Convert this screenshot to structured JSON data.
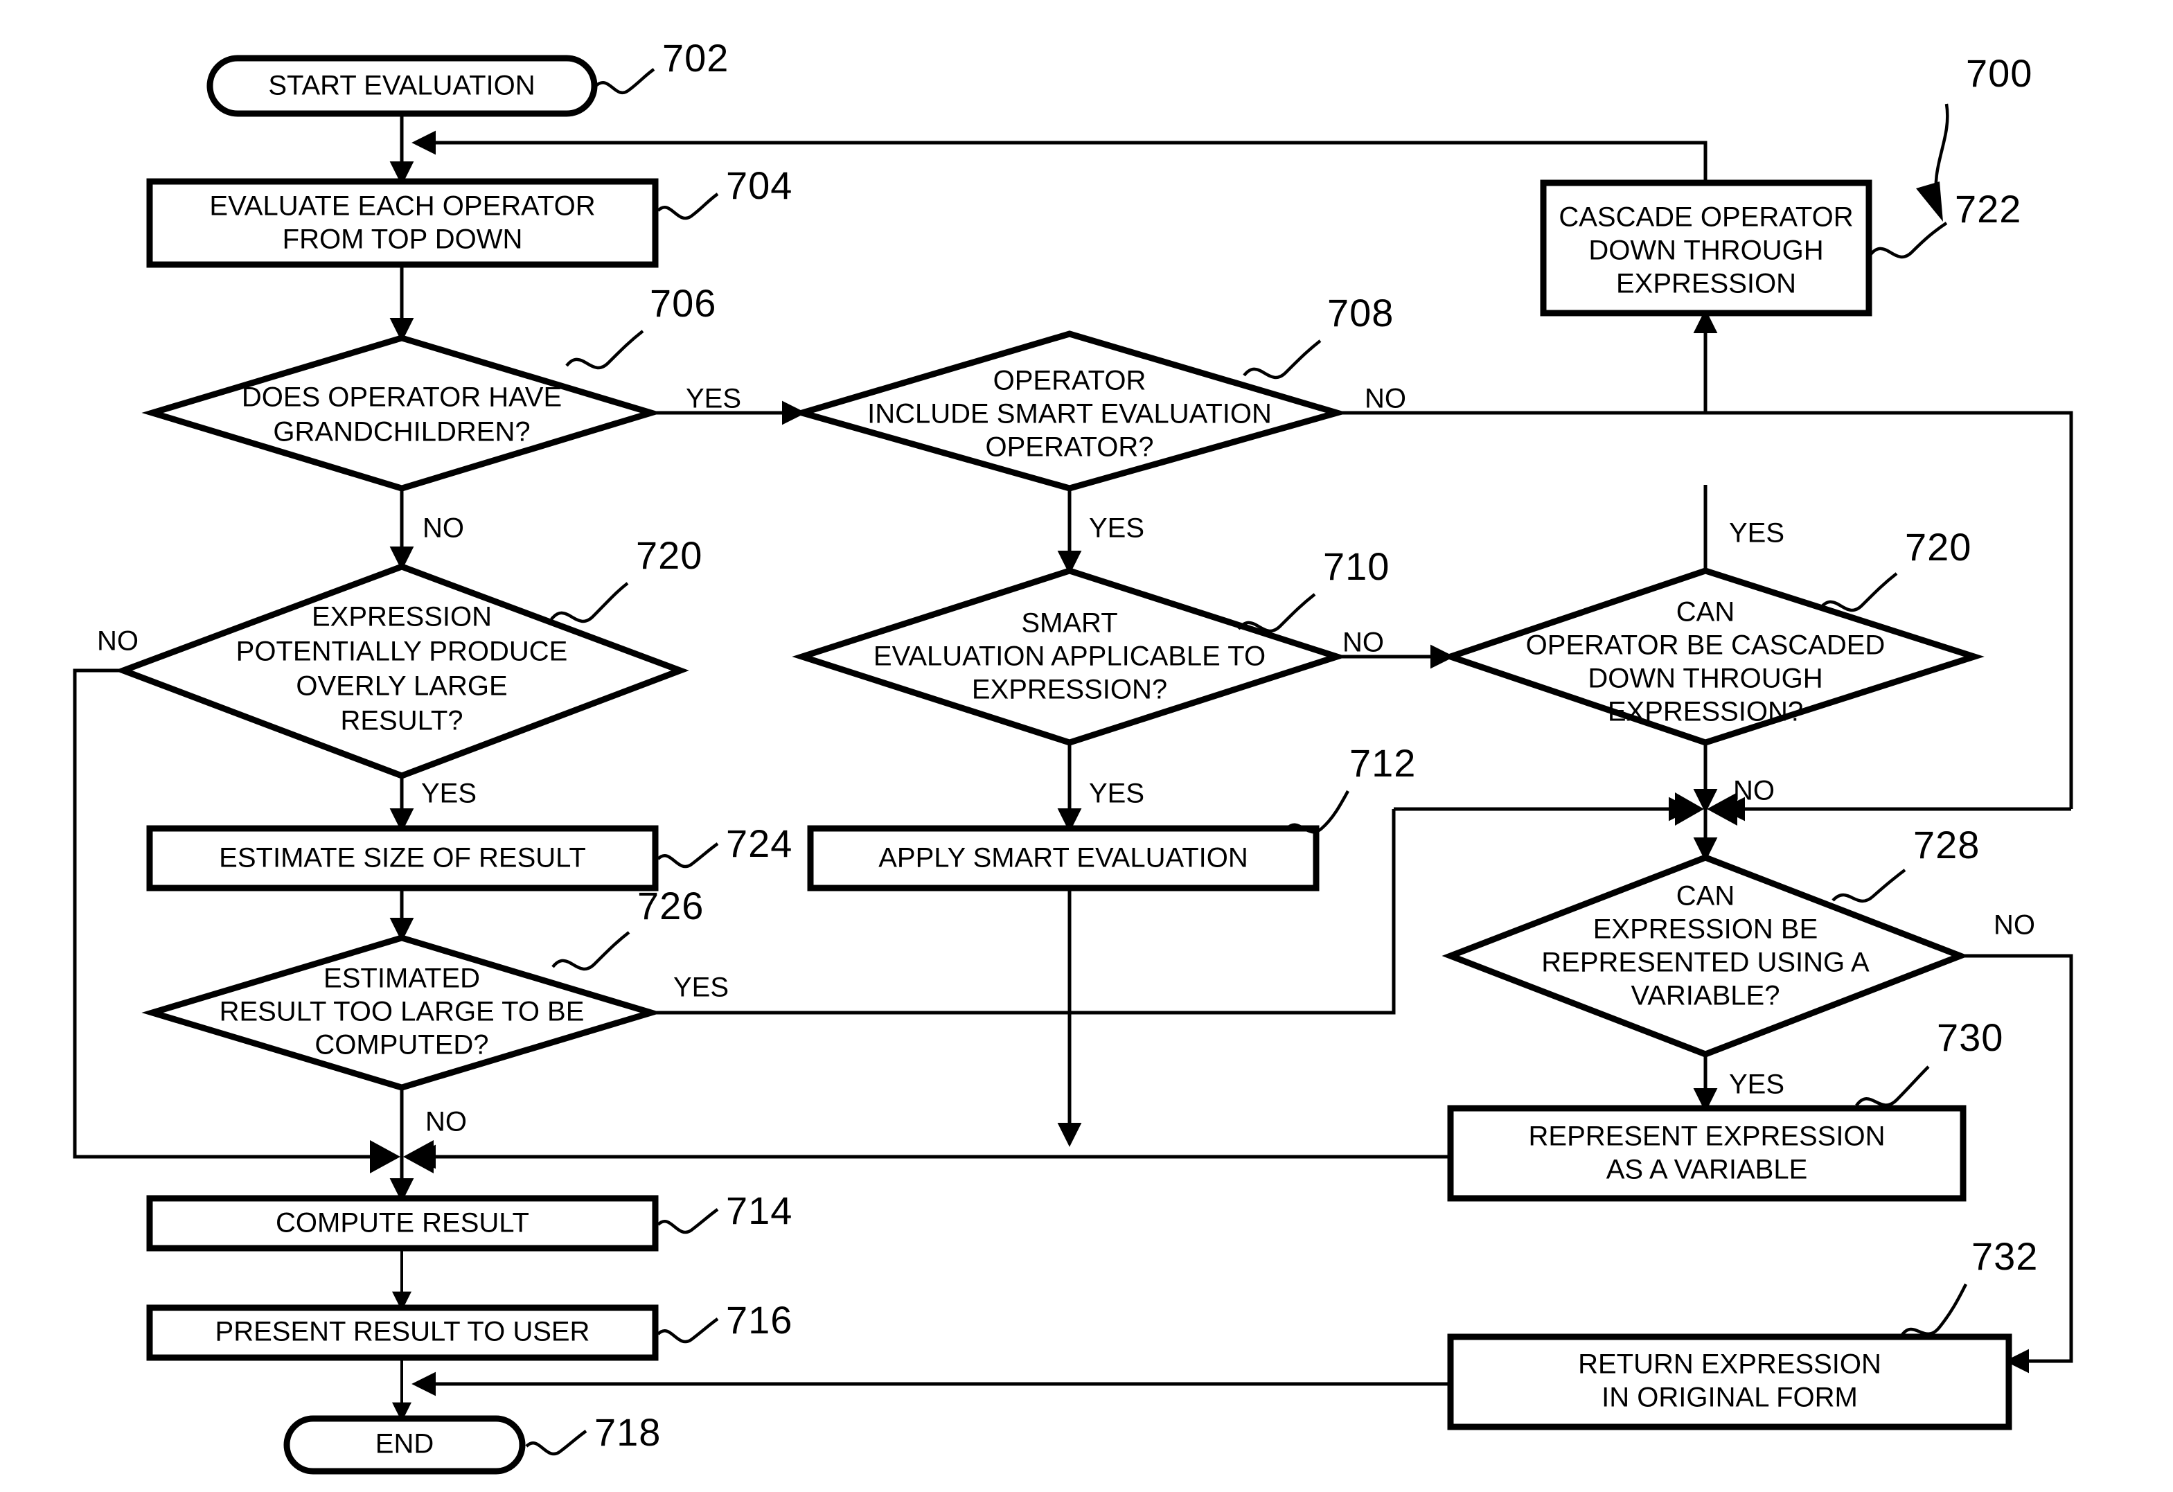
{
  "figure": {
    "type": "flowchart",
    "figure_reference": "700",
    "nodes": [
      {
        "id": "702",
        "ref": "702",
        "shape": "terminator",
        "lines": [
          "START EVALUATION"
        ]
      },
      {
        "id": "704",
        "ref": "704",
        "shape": "process",
        "lines": [
          "EVALUATE EACH OPERATOR",
          "FROM TOP DOWN"
        ]
      },
      {
        "id": "706",
        "ref": "706",
        "shape": "decision",
        "lines": [
          "DOES OPERATOR HAVE",
          "GRANDCHILDREN?"
        ]
      },
      {
        "id": "708",
        "ref": "708",
        "shape": "decision",
        "lines": [
          "OPERATOR",
          "INCLUDE SMART EVALUATION",
          "OPERATOR?"
        ]
      },
      {
        "id": "722",
        "ref": "722",
        "shape": "process",
        "lines": [
          "CASCADE OPERATOR",
          "DOWN  THROUGH",
          "EXPRESSION"
        ]
      },
      {
        "id": "720a",
        "ref": "720",
        "shape": "decision",
        "lines": [
          "EXPRESSION",
          "POTENTIALLY PRODUCE",
          "OVERLY LARGE",
          "RESULT?"
        ]
      },
      {
        "id": "710",
        "ref": "710",
        "shape": "decision",
        "lines": [
          "SMART",
          "EVALUATION  APPLICABLE TO",
          "EXPRESSION?"
        ]
      },
      {
        "id": "720b",
        "ref": "720",
        "shape": "decision",
        "lines": [
          "CAN",
          "OPERATOR BE CASCADED",
          "DOWN THROUGH",
          "EXPRESSION?"
        ]
      },
      {
        "id": "724",
        "ref": "724",
        "shape": "process",
        "lines": [
          "ESTIMATE SIZE OF RESULT"
        ]
      },
      {
        "id": "712",
        "ref": "712",
        "shape": "process",
        "lines": [
          "APPLY SMART EVALUATION"
        ]
      },
      {
        "id": "728",
        "ref": "728",
        "shape": "decision",
        "lines": [
          "CAN",
          "EXPRESSION BE",
          "REPRESENTED USING A",
          "VARIABLE?"
        ]
      },
      {
        "id": "726",
        "ref": "726",
        "shape": "decision",
        "lines": [
          "ESTIMATED",
          "RESULT TOO LARGE TO BE",
          "COMPUTED?"
        ]
      },
      {
        "id": "730",
        "ref": "730",
        "shape": "process",
        "lines": [
          "REPRESENT EXPRESSION",
          "AS A VARIABLE"
        ]
      },
      {
        "id": "714",
        "ref": "714",
        "shape": "process",
        "lines": [
          "COMPUTE RESULT"
        ]
      },
      {
        "id": "732",
        "ref": "732",
        "shape": "process",
        "lines": [
          "RETURN EXPRESSION",
          "IN ORIGINAL FORM"
        ]
      },
      {
        "id": "716",
        "ref": "716",
        "shape": "process",
        "lines": [
          "PRESENT RESULT TO USER"
        ]
      },
      {
        "id": "718",
        "ref": "718",
        "shape": "terminator",
        "lines": [
          "END"
        ]
      }
    ],
    "edge_labels": {
      "from_706_yes": "YES",
      "from_706_no": "NO",
      "from_708_no": "NO",
      "from_708_yes": "YES",
      "from_720a_no": "NO",
      "from_720a_yes": "YES",
      "from_710_no": "NO",
      "from_710_yes": "YES",
      "from_720b_yes": "YES",
      "from_720b_no": "NO",
      "from_726_yes": "YES",
      "from_726_no": "NO",
      "from_728_no": "NO",
      "from_728_yes": "YES"
    },
    "node_text": {
      "n702_l1": "START EVALUATION",
      "n704_l1": "EVALUATE EACH OPERATOR",
      "n704_l2": "FROM TOP DOWN",
      "n706_l1": "DOES OPERATOR HAVE",
      "n706_l2": "GRANDCHILDREN?",
      "n708_l1": "OPERATOR",
      "n708_l2": "INCLUDE SMART EVALUATION",
      "n708_l3": "OPERATOR?",
      "n722_l1": "CASCADE OPERATOR",
      "n722_l2": "DOWN  THROUGH",
      "n722_l3": "EXPRESSION",
      "n720a_l1": "EXPRESSION",
      "n720a_l2": "POTENTIALLY PRODUCE",
      "n720a_l3": "OVERLY LARGE",
      "n720a_l4": "RESULT?",
      "n710_l1": "SMART",
      "n710_l2": "EVALUATION  APPLICABLE TO",
      "n710_l3": "EXPRESSION?",
      "n720b_l1": "CAN",
      "n720b_l2": "OPERATOR BE CASCADED",
      "n720b_l3": "DOWN THROUGH",
      "n720b_l4": "EXPRESSION?",
      "n724_l1": "ESTIMATE SIZE OF RESULT",
      "n712_l1": "APPLY SMART EVALUATION",
      "n728_l1": "CAN",
      "n728_l2": "EXPRESSION BE",
      "n728_l3": "REPRESENTED USING A",
      "n728_l4": "VARIABLE?",
      "n726_l1": "ESTIMATED",
      "n726_l2": "RESULT TOO LARGE TO BE",
      "n726_l3": "COMPUTED?",
      "n730_l1": "REPRESENT EXPRESSION",
      "n730_l2": "AS A VARIABLE",
      "n714_l1": "COMPUTE RESULT",
      "n732_l1": "RETURN EXPRESSION",
      "n732_l2": "IN ORIGINAL FORM",
      "n716_l1": "PRESENT RESULT TO USER",
      "n718_l1": "END"
    },
    "ref_labels": {
      "r700": "700",
      "r702": "702",
      "r704": "704",
      "r706": "706",
      "r708": "708",
      "r710": "710",
      "r712": "712",
      "r714": "714",
      "r716": "716",
      "r718": "718",
      "r720a": "720",
      "r720b": "720",
      "r722": "722",
      "r724": "724",
      "r726": "726",
      "r728": "728",
      "r730": "730",
      "r732": "732"
    },
    "colors": {
      "stroke": "#000000",
      "fill": "#ffffff",
      "background": "#ffffff"
    }
  }
}
